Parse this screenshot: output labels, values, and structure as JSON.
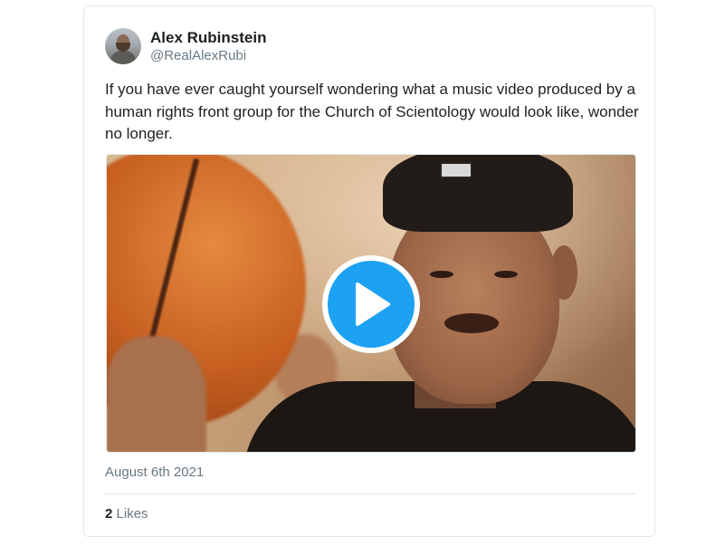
{
  "tweet": {
    "author_name": "Alex Rubinstein",
    "author_handle": "@RealAlexRubi",
    "text": "If you have ever caught yourself wondering what a music video produced by a human rights front group for the Church of Scientology would look like, wonder no longer.",
    "date": "August 6th 2021",
    "likes_count": "2",
    "likes_label": "Likes"
  },
  "media": {
    "type": "video",
    "play_icon": "play-icon",
    "accent_color": "#1da1f2"
  },
  "colors": {
    "text_primary": "#1c2022",
    "text_secondary": "#697882",
    "border": "#e1e8ed"
  }
}
